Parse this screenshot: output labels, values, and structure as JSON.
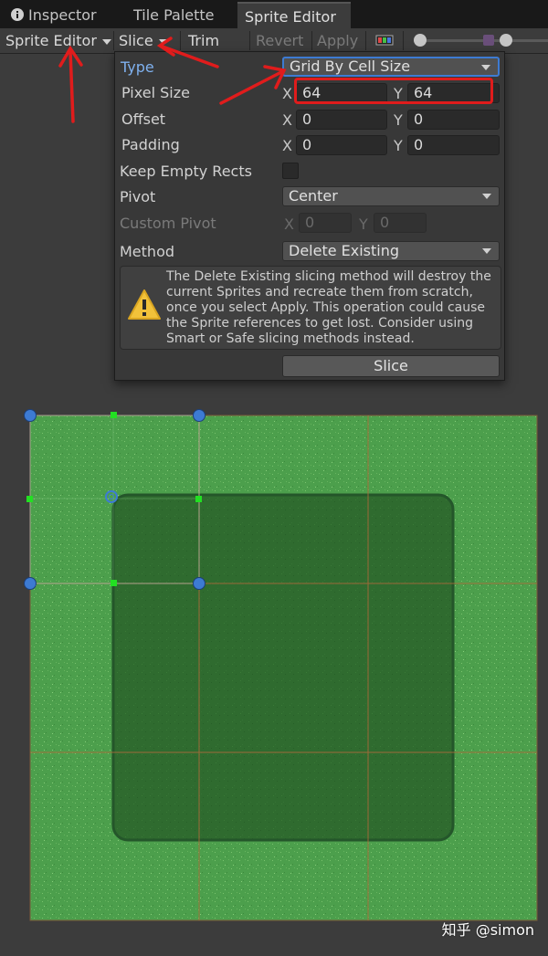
{
  "tabs": [
    {
      "label": "Inspector",
      "icon": "info-icon"
    },
    {
      "label": "Tile Palette"
    },
    {
      "label": "Sprite Editor"
    }
  ],
  "toolbar": {
    "mode": "Sprite Editor",
    "slice": "Slice",
    "trim": "Trim",
    "revert": "Revert",
    "apply": "Apply"
  },
  "panel": {
    "type_label": "Type",
    "type_value": "Grid By Cell Size",
    "pixel_size_label": "Pixel Size",
    "pixel_x": "64",
    "pixel_y": "64",
    "offset_label": "Offset",
    "offset_x": "0",
    "offset_y": "0",
    "padding_label": "Padding",
    "padding_x": "0",
    "padding_y": "0",
    "keep_empty_label": "Keep Empty Rects",
    "pivot_label": "Pivot",
    "pivot_value": "Center",
    "custom_pivot_label": "Custom Pivot",
    "custom_x": "0",
    "custom_y": "0",
    "method_label": "Method",
    "method_value": "Delete Existing",
    "warning": "The Delete Existing slicing method will destroy the current Sprites and recreate them from scratch, once you select Apply. This operation could cause the Sprite references to get lost. Consider using Smart or Safe slicing methods instead.",
    "slice_button": "Slice",
    "x_label": "X",
    "y_label": "Y"
  },
  "watermark": "知乎 @simon",
  "colors": {
    "annotation_red": "#e01c1c",
    "focus_blue": "#3d7bd3",
    "grass_light": "#4ea24e",
    "grass_dark": "#2d6a2d",
    "grid_line": "#b06a3a"
  }
}
